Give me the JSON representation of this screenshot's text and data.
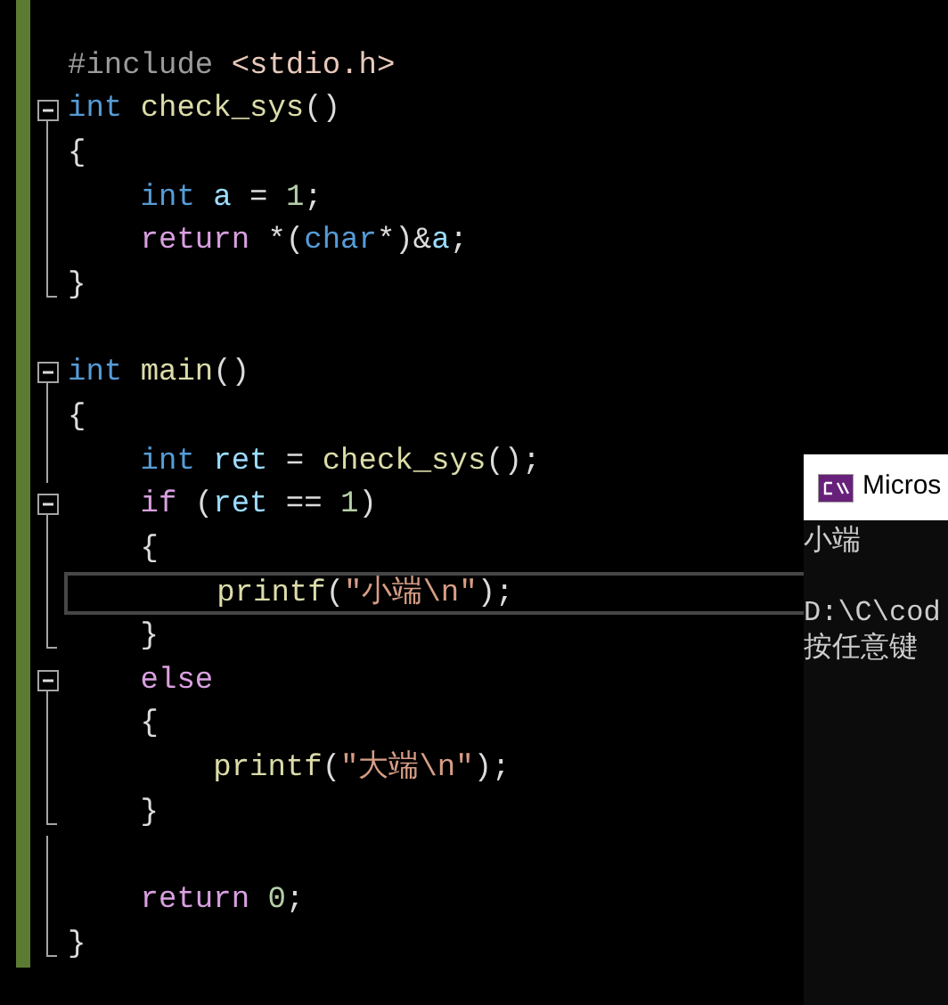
{
  "editor": {
    "lines": [
      {
        "kind": "plain",
        "current": false,
        "tokens": [
          {
            "kind": "preprocessor",
            "text": "#include "
          },
          {
            "kind": "include",
            "text": "<stdio.h>"
          }
        ]
      },
      {
        "kind": "collapsible",
        "current": false,
        "tokens": [
          {
            "kind": "keyword",
            "text": "int "
          },
          {
            "kind": "function",
            "text": "check_sys"
          },
          {
            "kind": "plain",
            "text": "()"
          }
        ]
      },
      {
        "kind": "inner",
        "current": false,
        "tokens": [
          {
            "kind": "plain",
            "text": "{"
          }
        ]
      },
      {
        "kind": "inner",
        "current": false,
        "tokens": [
          {
            "kind": "keyword",
            "text": "    int "
          },
          {
            "kind": "variable",
            "text": "a"
          },
          {
            "kind": "plain",
            "text": " = "
          },
          {
            "kind": "number",
            "text": "1"
          },
          {
            "kind": "plain",
            "text": ";"
          }
        ]
      },
      {
        "kind": "inner",
        "current": false,
        "tokens": [
          {
            "kind": "control",
            "text": "    return"
          },
          {
            "kind": "plain",
            "text": " *("
          },
          {
            "kind": "keyword",
            "text": "char"
          },
          {
            "kind": "plain",
            "text": "*)&"
          },
          {
            "kind": "variable",
            "text": "a"
          },
          {
            "kind": "plain",
            "text": ";"
          }
        ]
      },
      {
        "kind": "closing",
        "current": false,
        "tokens": [
          {
            "kind": "plain",
            "text": "}"
          }
        ]
      },
      {
        "kind": "plain",
        "current": false
      },
      {
        "kind": "collapsible",
        "current": false,
        "tokens": [
          {
            "kind": "keyword",
            "text": "int "
          },
          {
            "kind": "function",
            "text": "main"
          },
          {
            "kind": "plain",
            "text": "()"
          }
        ]
      },
      {
        "kind": "inner",
        "current": false,
        "tokens": [
          {
            "kind": "plain",
            "text": "{"
          }
        ]
      },
      {
        "kind": "inner",
        "current": false,
        "tokens": [
          {
            "kind": "keyword",
            "text": "    int "
          },
          {
            "kind": "variable",
            "text": "ret"
          },
          {
            "kind": "plain",
            "text": " = "
          },
          {
            "kind": "function",
            "text": "check_sys"
          },
          {
            "kind": "plain",
            "text": "();"
          }
        ]
      },
      {
        "kind": "collapsible",
        "current": false,
        "tokens": [
          {
            "kind": "control",
            "text": "    if"
          },
          {
            "kind": "plain",
            "text": " ("
          },
          {
            "kind": "variable",
            "text": "ret"
          },
          {
            "kind": "plain",
            "text": " == "
          },
          {
            "kind": "number",
            "text": "1"
          },
          {
            "kind": "plain",
            "text": ")"
          }
        ]
      },
      {
        "kind": "inner",
        "current": false,
        "tokens": [
          {
            "kind": "plain",
            "text": "    {"
          }
        ]
      },
      {
        "kind": "inner",
        "current": true,
        "tokens": [
          {
            "kind": "function",
            "text": "        printf"
          },
          {
            "kind": "plain",
            "text": "("
          },
          {
            "kind": "string",
            "text": "\"小端\\n\""
          },
          {
            "kind": "plain",
            "text": ");"
          }
        ]
      },
      {
        "kind": "closing",
        "current": false,
        "tokens": [
          {
            "kind": "plain",
            "text": "    }"
          }
        ]
      },
      {
        "kind": "collapsible",
        "current": false,
        "tokens": [
          {
            "kind": "control",
            "text": "    else"
          }
        ]
      },
      {
        "kind": "inner",
        "current": false,
        "tokens": [
          {
            "kind": "plain",
            "text": "    {"
          }
        ]
      },
      {
        "kind": "inner",
        "current": false,
        "tokens": [
          {
            "kind": "function",
            "text": "        printf"
          },
          {
            "kind": "plain",
            "text": "("
          },
          {
            "kind": "string",
            "text": "\"大端\\n\""
          },
          {
            "kind": "plain",
            "text": ");"
          }
        ]
      },
      {
        "kind": "closing",
        "current": false,
        "tokens": [
          {
            "kind": "plain",
            "text": "    }"
          }
        ]
      },
      {
        "kind": "inner",
        "current": false
      },
      {
        "kind": "inner",
        "current": false,
        "tokens": [
          {
            "kind": "control",
            "text": "    return "
          },
          {
            "kind": "number",
            "text": "0"
          },
          {
            "kind": "plain",
            "text": ";"
          }
        ]
      },
      {
        "kind": "closing",
        "current": false,
        "tokens": [
          {
            "kind": "plain",
            "text": "}"
          }
        ]
      }
    ]
  },
  "console": {
    "title": "Micros",
    "output": "小端",
    "prompt_lines": [
      "D:\\C\\cod",
      "按任意键"
    ]
  }
}
